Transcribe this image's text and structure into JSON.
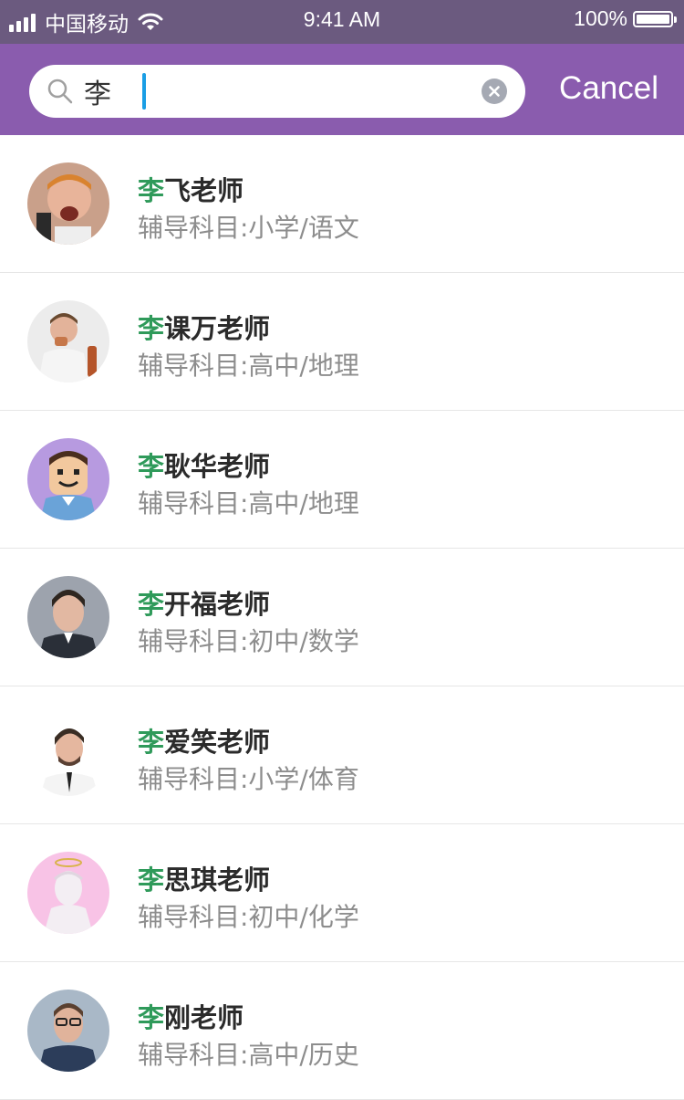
{
  "status_bar": {
    "carrier": "中国移动",
    "time": "9:41 AM",
    "battery": "100%"
  },
  "search": {
    "query": "李",
    "cancel_label": "Cancel"
  },
  "colors": {
    "header": "#8a5cae",
    "status_bar": "#6b5a7f",
    "highlight": "#2f9a5a",
    "caret": "#1a9ee5"
  },
  "results": [
    {
      "highlight": "李",
      "name_rest": "飞老师",
      "subject": "辅导科目:小学/语文"
    },
    {
      "highlight": "李",
      "name_rest": "课万老师",
      "subject": "辅导科目:高中/地理"
    },
    {
      "highlight": "李",
      "name_rest": "耿华老师",
      "subject": "辅导科目:高中/地理"
    },
    {
      "highlight": "李",
      "name_rest": "开福老师",
      "subject": "辅导科目:初中/数学"
    },
    {
      "highlight": "李",
      "name_rest": "爱笑老师",
      "subject": "辅导科目:小学/体育"
    },
    {
      "highlight": "李",
      "name_rest": "思琪老师",
      "subject": "辅导科目:初中/化学"
    },
    {
      "highlight": "李",
      "name_rest": "刚老师",
      "subject": "辅导科目:高中/历史"
    }
  ]
}
